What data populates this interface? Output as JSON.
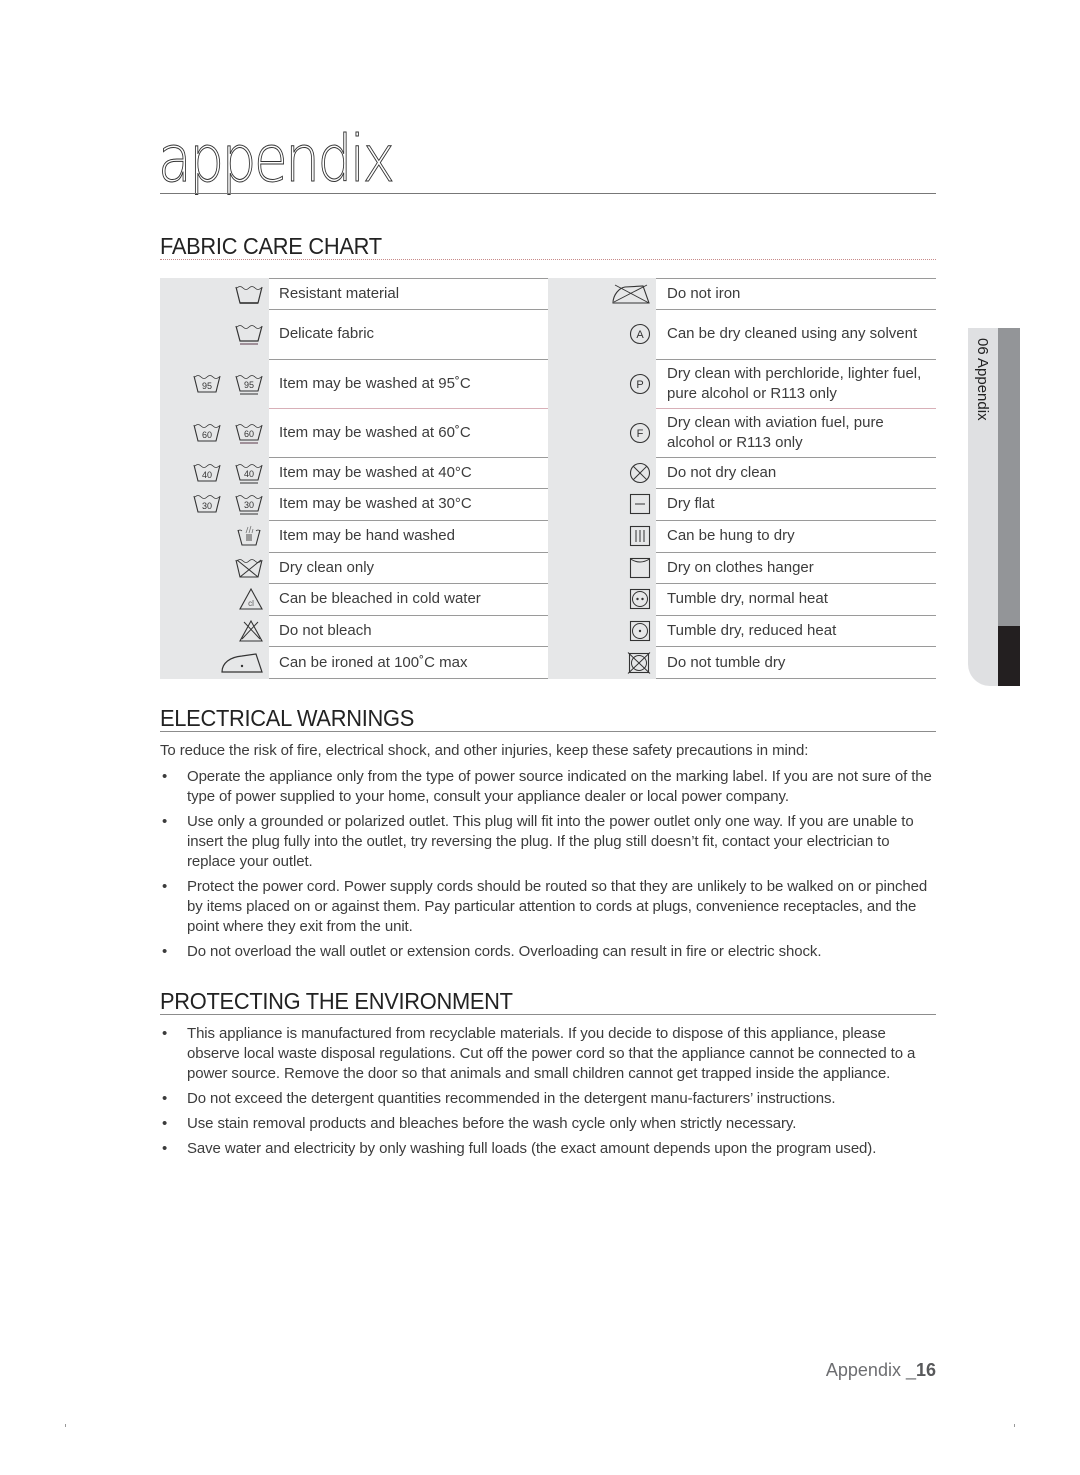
{
  "page": {
    "title": "appendix",
    "footer_label": "Appendix _",
    "page_number": "16"
  },
  "side_tab": {
    "label": "06 Appendix"
  },
  "fabric_care": {
    "heading": "FABRIC CARE CHART",
    "left": [
      {
        "icon": "wash-tub-icon",
        "label": "Resistant material"
      },
      {
        "icon": "wash-tub-delicate-icon",
        "label": "Delicate fabric"
      },
      {
        "icon": "wash-95-icon",
        "label": "Item may be washed at 95˚C"
      },
      {
        "icon": "wash-60-icon",
        "label": "Item may be washed at 60˚C"
      },
      {
        "icon": "wash-40-icon",
        "label": "Item may be washed at 40°C"
      },
      {
        "icon": "wash-30-icon",
        "label": "Item may be washed at 30°C"
      },
      {
        "icon": "hand-wash-icon",
        "label": "Item may be hand washed"
      },
      {
        "icon": "do-not-wash-icon",
        "label": "Dry clean only"
      },
      {
        "icon": "bleach-cold-icon",
        "label": "Can be bleached in cold water"
      },
      {
        "icon": "do-not-bleach-icon",
        "label": "Do not bleach"
      },
      {
        "icon": "iron-low-icon",
        "label": "Can be ironed at 100˚C max"
      }
    ],
    "right": [
      {
        "icon": "do-not-iron-icon",
        "label": "Do not iron"
      },
      {
        "icon": "dry-clean-a-icon",
        "label": "Can be dry cleaned using any solvent",
        "letter": "A"
      },
      {
        "icon": "dry-clean-p-icon",
        "label": "Dry clean with perchloride, lighter fuel, pure alcohol or R113 only",
        "letter": "P"
      },
      {
        "icon": "dry-clean-f-icon",
        "label": "Dry clean with aviation fuel, pure alcohol or R113 only",
        "letter": "F"
      },
      {
        "icon": "do-not-dry-clean-icon",
        "label": "Do not dry clean"
      },
      {
        "icon": "dry-flat-icon",
        "label": "Dry flat"
      },
      {
        "icon": "line-dry-icon",
        "label": "Can be hung to dry"
      },
      {
        "icon": "hanger-dry-icon",
        "label": "Dry on clothes hanger"
      },
      {
        "icon": "tumble-dry-normal-icon",
        "label": "Tumble dry, normal heat"
      },
      {
        "icon": "tumble-dry-low-icon",
        "label": "Tumble dry, reduced heat"
      },
      {
        "icon": "do-not-tumble-dry-icon",
        "label": "Do not tumble dry"
      }
    ]
  },
  "electrical": {
    "heading": "ELECTRICAL WARNINGS",
    "intro": "To reduce the risk of fire, electrical shock, and other injuries, keep these safety precautions in mind:",
    "bullets": [
      "Operate the appliance only from the type of power source indicated on the marking label. If you are not sure of the type of power supplied to your home, consult your appliance dealer or local power company.",
      "Use only a grounded or polarized outlet. This plug will fit into the power outlet only one way. If you are unable to insert the plug fully into the outlet, try reversing the plug. If the plug still doesn’t fit, contact your electrician to replace your outlet.",
      "Protect the power cord. Power supply cords should be routed so that they are unlikely to be walked on or pinched by items placed on or against them. Pay particular attention to cords at plugs, convenience receptacles, and the point where they exit from the unit.",
      "Do not overload the wall outlet or extension cords. Overloading can result in fire or electric shock."
    ]
  },
  "environment": {
    "heading": "PROTECTING THE ENVIRONMENT",
    "bullets": [
      "This appliance is manufactured from recyclable materials. If you decide to dispose of this appliance, please observe local waste disposal regulations. Cut off the power cord so that the appliance cannot be connected to a power source. Remove the door so that animals and small children cannot get trapped inside the appliance.",
      "Do not exceed the detergent quantities recommended in the detergent manu-facturers’ instructions.",
      "Use stain removal products and bleaches before the wash cycle only when strictly necessary.",
      "Save water and electricity by only washing full loads (the exact amount depends upon the program used)."
    ]
  },
  "bullet_char": "•"
}
